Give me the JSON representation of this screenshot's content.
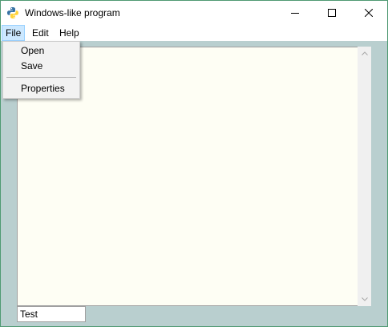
{
  "window": {
    "title": "Windows-like program",
    "icon": "python-icon",
    "controls": [
      "minimize-icon",
      "maximize-icon",
      "close-icon"
    ]
  },
  "menubar": {
    "items": [
      {
        "label": "File"
      },
      {
        "label": "Edit"
      },
      {
        "label": "Help"
      }
    ]
  },
  "file_menu": {
    "items": [
      {
        "label": "Open"
      },
      {
        "label": "Save"
      },
      {
        "label": "Properties"
      }
    ]
  },
  "entry": {
    "value": "Test"
  },
  "colors": {
    "window_border": "#4f9a73",
    "client_background": "#b9cfcf",
    "textarea_background": "#fefef4",
    "menu_highlight": "#cce8ff"
  }
}
